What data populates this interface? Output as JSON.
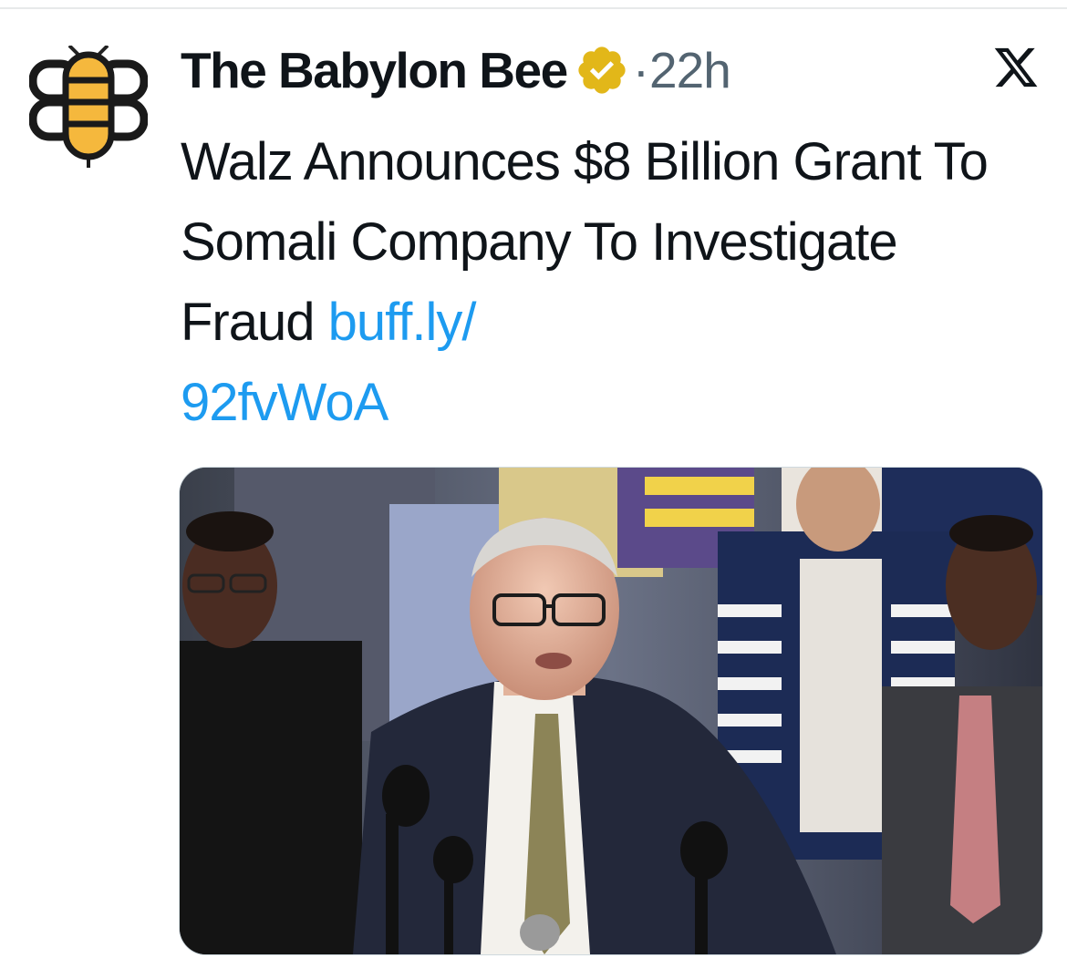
{
  "tweet": {
    "author_name": "The Babylon Bee",
    "dot": "·",
    "time": "22h",
    "text": "Walz Announces $8 Billion Grant To Somali Company To Investigate Fraud",
    "link_part1": "buff.ly/",
    "link_part2": "92fvWoA"
  },
  "icons": {
    "avatar": "babylon-bee-logo",
    "verified": "gold-verified-badge",
    "platform": "x-logo"
  },
  "colors": {
    "text": "#0f1419",
    "secondary": "#536471",
    "link": "#1d9bf0",
    "badge": "#e2b719",
    "bee_yellow": "#f5b83d"
  }
}
